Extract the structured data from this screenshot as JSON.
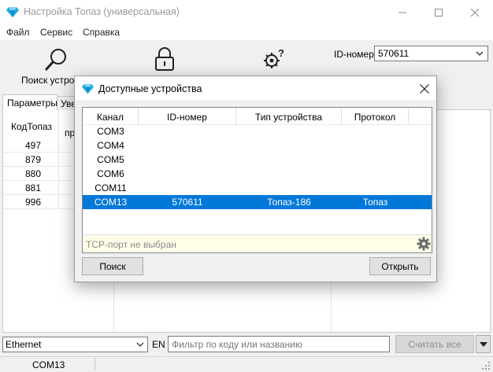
{
  "window": {
    "title": "Настройка Топаз (универсальная)",
    "icon": "gem-icon",
    "controls": [
      "minimize-icon",
      "maximize-icon",
      "close-icon"
    ]
  },
  "menu": [
    "Файл",
    "Сервис",
    "Справка"
  ],
  "toolbar": {
    "search_label": "Поиск устрой",
    "search_icon": "magnifier-icon",
    "lock_icon": "padlock-icon",
    "settings_icon": "gear-question-icon",
    "id_label": "ID-номер",
    "id_value": "570611"
  },
  "tabs": [
    "Параметры",
    "Уве"
  ],
  "main_table": {
    "headers": [
      "КодТопаз",
      "пр"
    ],
    "rows": [
      "497",
      "879",
      "880",
      "881",
      "996"
    ]
  },
  "bottom": {
    "transport": "Ethernet",
    "lang": "EN",
    "filter_placeholder": "Фильтр по коду или названию",
    "read_all": "Считать все"
  },
  "status": {
    "port": "COM13"
  },
  "dialog": {
    "title": "Доступные устройства",
    "columns": [
      "Канал",
      "ID-номер",
      "Тип устройства",
      "Протокол"
    ],
    "rows": [
      {
        "channel": "COM3",
        "id": "",
        "type": "",
        "protocol": ""
      },
      {
        "channel": "COM4",
        "id": "",
        "type": "",
        "protocol": ""
      },
      {
        "channel": "COM5",
        "id": "",
        "type": "",
        "protocol": ""
      },
      {
        "channel": "COM6",
        "id": "",
        "type": "",
        "protocol": ""
      },
      {
        "channel": "COM11",
        "id": "",
        "type": "",
        "protocol": ""
      },
      {
        "channel": "COM13",
        "id": "570611",
        "type": "Топаз-186",
        "protocol": "Топаз"
      }
    ],
    "selected_row": 5,
    "tcp_status": "TCP-порт не выбран",
    "search_button": "Поиск",
    "open_button": "Открыть"
  },
  "colors": {
    "selection": "#0078d7",
    "gem": "#19a9e6",
    "tcp_bg": "#fffde8"
  }
}
